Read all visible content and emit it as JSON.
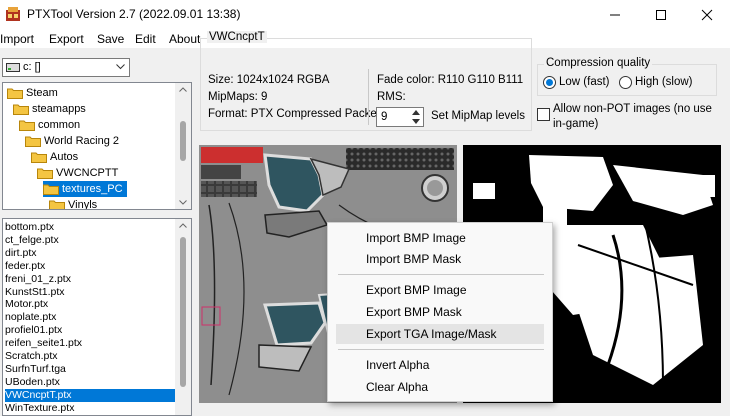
{
  "window": {
    "title": "PTXTool Version 2.7 (2022.09.01 13:38)",
    "minimize_glyph": "—",
    "maximize_glyph": "☐",
    "close_glyph": "✕"
  },
  "menu": [
    "Import",
    "Export",
    "Save",
    "Edit",
    "About"
  ],
  "drive": {
    "value": "c: []",
    "icon": "drive-icon"
  },
  "tree": [
    {
      "label": "Steam",
      "indent": 0
    },
    {
      "label": "steamapps",
      "indent": 1
    },
    {
      "label": "common",
      "indent": 2
    },
    {
      "label": "World Racing 2",
      "indent": 3
    },
    {
      "label": "Autos",
      "indent": 4
    },
    {
      "label": "VWCNCPTT",
      "indent": 5
    },
    {
      "label": "textures_PC",
      "indent": 6,
      "selected": true
    },
    {
      "label": "Vinyls",
      "indent": 7
    }
  ],
  "files": [
    "bottom.ptx",
    "ct_felge.ptx",
    "dirt.ptx",
    "feder.ptx",
    "freni_01_z.ptx",
    "KunstSt1.ptx",
    "Motor.ptx",
    "noplate.ptx",
    "profiel01.ptx",
    "reifen_seite1.ptx",
    "Scratch.ptx",
    "SurfnTurf.tga",
    "UBoden.ptx",
    "VWCncptT.ptx",
    "WinTexture.ptx"
  ],
  "selected_file": "VWCncptT.ptx",
  "info": {
    "group_title": "VWCncptT",
    "size": "Size: 1024x1024 RGBA",
    "mipmaps": "MipMaps: 9",
    "format": "Format: PTX Compressed Packed",
    "fade_color": "Fade color: R110  G110  B111",
    "rms": "RMS:",
    "mip_value": "9",
    "set_mip": "Set MipMap levels"
  },
  "compression": {
    "title": "Compression quality",
    "low": "Low (fast)",
    "high": "High (slow)",
    "selected": "low",
    "allow_non_pot": "Allow non-POT images (no use in-game)",
    "allow_non_pot_checked": false
  },
  "context_menu": [
    {
      "label": "Import BMP Image"
    },
    {
      "label": "Import BMP Mask"
    },
    {
      "separator": true
    },
    {
      "label": "Export BMP Image"
    },
    {
      "label": "Export BMP Mask"
    },
    {
      "label": "Export TGA Image/Mask",
      "highlighted": true
    },
    {
      "separator": true
    },
    {
      "label": "Invert Alpha"
    },
    {
      "label": "Clear Alpha"
    }
  ],
  "colors": {
    "selection": "#0078d7",
    "folder": "#f4c542",
    "texture_teal": "#2f5560"
  }
}
